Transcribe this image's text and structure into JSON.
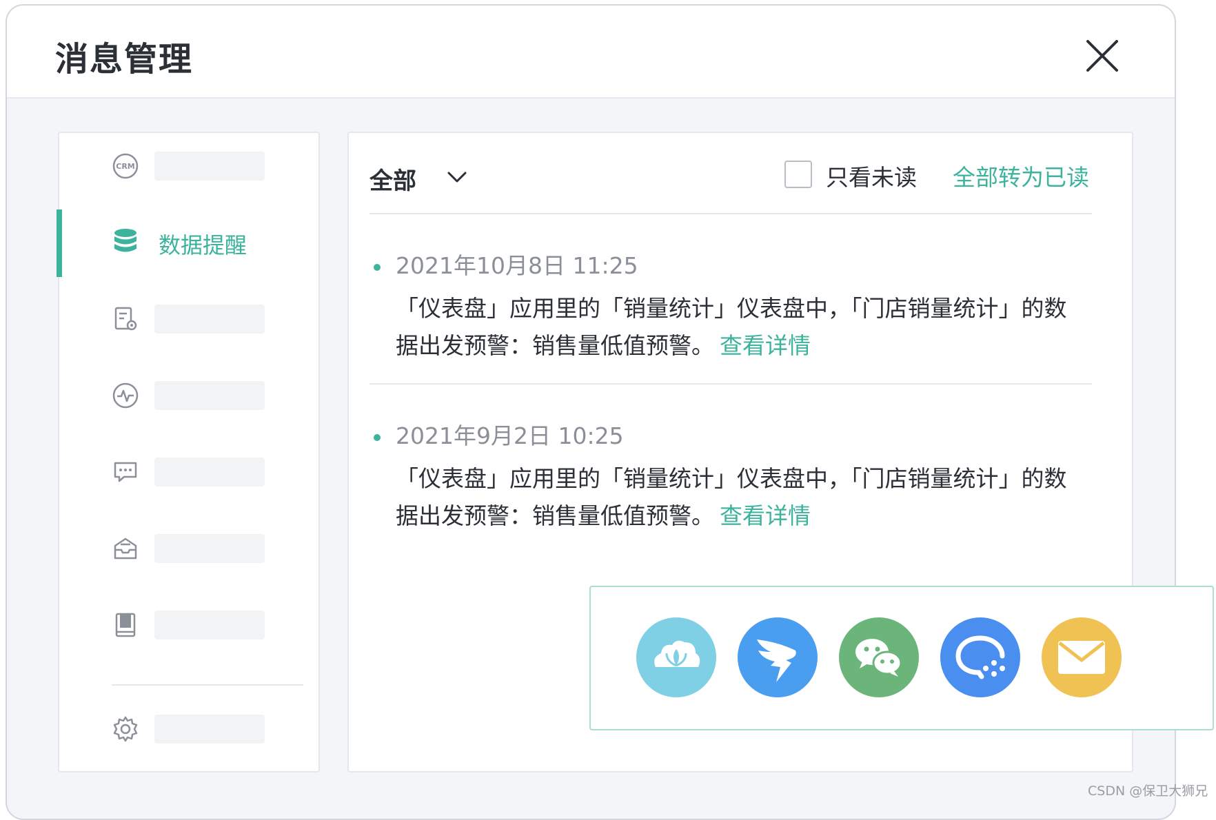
{
  "dialog": {
    "title": "消息管理"
  },
  "sidebar": {
    "active_label": "数据提醒",
    "items": [
      {
        "icon": "crm-icon"
      },
      {
        "icon": "database-icon",
        "label": "数据提醒",
        "active": true
      },
      {
        "icon": "form-settings-icon"
      },
      {
        "icon": "activity-icon"
      },
      {
        "icon": "chat-icon"
      },
      {
        "icon": "inbox-icon"
      },
      {
        "icon": "book-icon"
      },
      {
        "icon": "gear-icon"
      }
    ]
  },
  "toolbar": {
    "filter_value": "全部",
    "unread_only_label": "只看未读",
    "mark_all_read_label": "全部转为已读"
  },
  "messages": [
    {
      "time": "2021年10月8日 11:25",
      "text": "「仪表盘」应用里的「销量统计」仪表盘中，「门店销量统计」的数据出发预警：销售量低值预警。",
      "link": "查看详情"
    },
    {
      "time": "2021年9月2日 10:25",
      "text": "「仪表盘」应用里的「销量统计」仪表盘中，「门店销量统计」的数据出发预警：销售量低值预警。",
      "link": "查看详情"
    }
  ],
  "share_channels": [
    {
      "icon": "cloud-app-icon",
      "color": "#7fd0e4"
    },
    {
      "icon": "dingtalk-icon",
      "color": "#4a9ef0"
    },
    {
      "icon": "wechat-icon",
      "color": "#6bb57a"
    },
    {
      "icon": "work-chat-icon",
      "color": "#4a8ef0"
    },
    {
      "icon": "mail-icon",
      "color": "#f0c253"
    }
  ],
  "watermark": "CSDN @保卫大狮兄",
  "colors": {
    "accent": "#3db39e",
    "text": "#2b2f36",
    "muted": "#8a8f98"
  }
}
